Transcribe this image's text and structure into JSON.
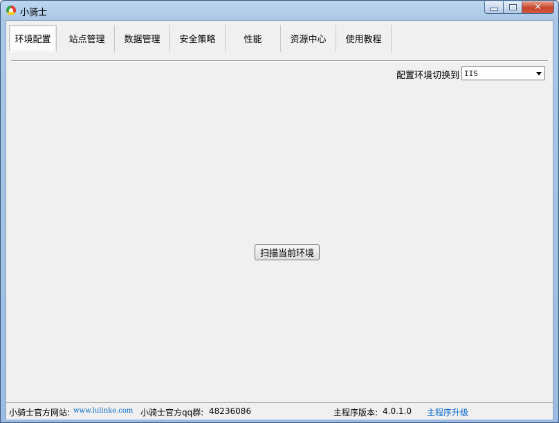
{
  "window": {
    "title": "小骑士",
    "close_glyph": "✕"
  },
  "tabs": [
    {
      "label": "环境配置",
      "active": true
    },
    {
      "label": "站点管理",
      "active": false
    },
    {
      "label": "数据管理",
      "active": false
    },
    {
      "label": "安全策略",
      "active": false
    },
    {
      "label": "性能",
      "active": false
    },
    {
      "label": "资源中心",
      "active": false
    },
    {
      "label": "使用教程",
      "active": false
    }
  ],
  "env_switch": {
    "label": "配置环境切换到",
    "selected": "IIS"
  },
  "scan_button_label": "扫描当前环境",
  "status": {
    "site_label": "小骑士官方网站:",
    "site_url": "www.lulinke.com",
    "qq_label": "小骑士官方qq群:",
    "qq_number": "48236086",
    "version_label": "主程序版本:",
    "version": "4.0.1.0",
    "upgrade_link": "主程序升级"
  },
  "colors": {
    "link": "#0066cc",
    "close_button": "#c7432a",
    "title_bar": "#a9c7e6"
  },
  "icons": [
    "app-logo-icon",
    "minimize-icon",
    "maximize-icon",
    "close-icon",
    "dropdown-arrow-icon"
  ]
}
